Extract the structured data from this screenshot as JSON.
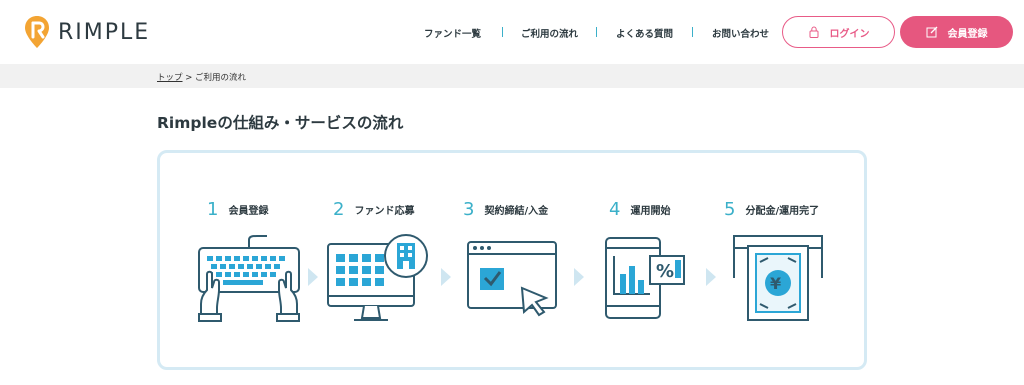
{
  "header": {
    "logo_text": "RIMPLE",
    "nav": [
      {
        "label": "ファンド一覧"
      },
      {
        "label": "ご利用の流れ"
      },
      {
        "label": "よくある質問"
      },
      {
        "label": "お問い合わせ"
      }
    ],
    "login_label": "ログイン",
    "register_label": "会員登録"
  },
  "breadcrumb": {
    "home": "トップ",
    "separator": ">",
    "current": "ご利用の流れ"
  },
  "page_title": "Rimpleの仕組み・サービスの流れ",
  "steps": [
    {
      "number": "1",
      "label": "会員登録",
      "icon": "keyboard-hands-icon"
    },
    {
      "number": "2",
      "label": "ファンド応募",
      "icon": "monitor-building-icon"
    },
    {
      "number": "3",
      "label": "契約締結/入金",
      "icon": "browser-checkbox-icon"
    },
    {
      "number": "4",
      "label": "運用開始",
      "icon": "tablet-chart-icon"
    },
    {
      "number": "5",
      "label": "分配金/運用完了",
      "icon": "banknote-icon"
    }
  ],
  "colors": {
    "accent": "#3bb0c9",
    "brand_pink": "#e6577f",
    "text": "#2d3a40",
    "illus_dark": "#2f5a6e",
    "illus_blue": "#2ba6d6",
    "box_border": "#d5eaf4"
  }
}
